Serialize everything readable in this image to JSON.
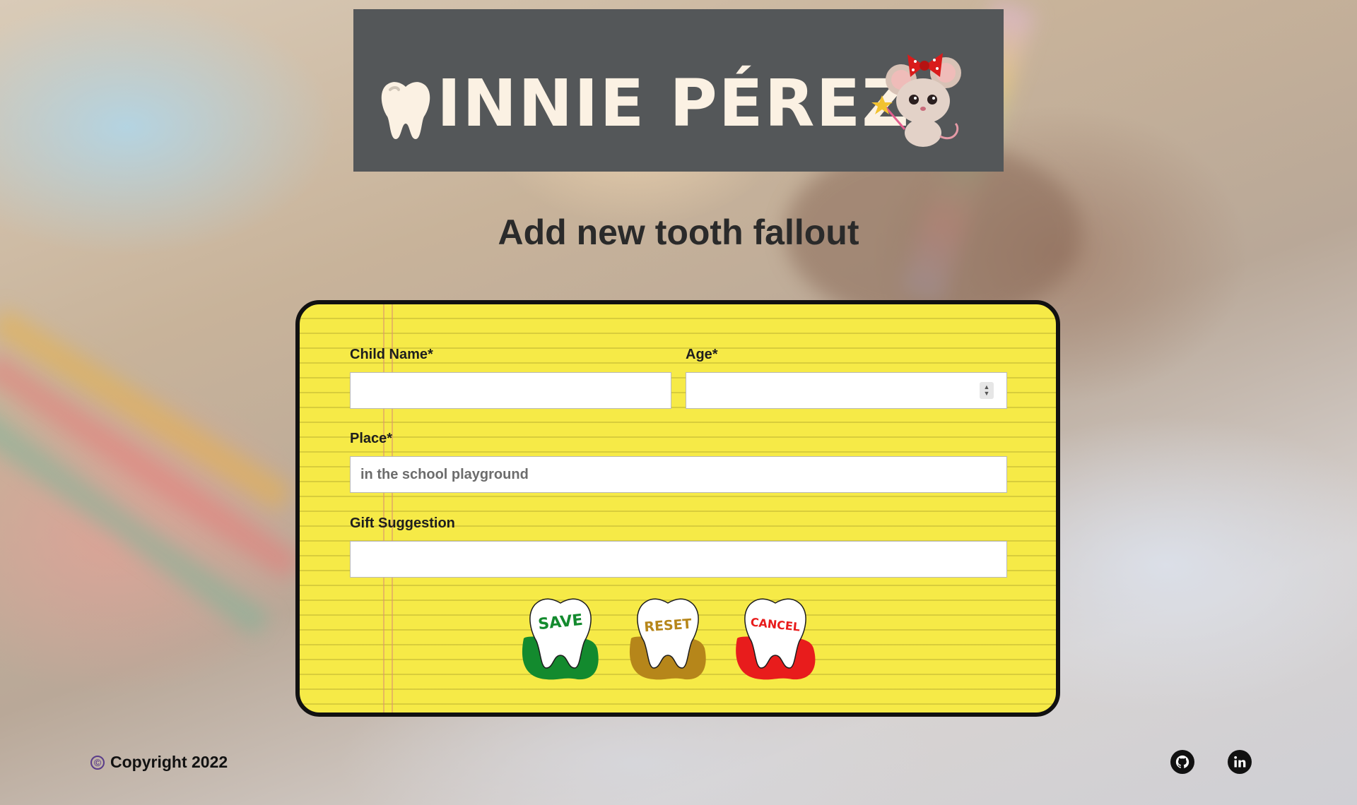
{
  "brand": {
    "name": "INNIE PÉREZ",
    "banner_bg": "#545759",
    "text_color": "#fbf1e3"
  },
  "page": {
    "title": "Add new tooth fallout"
  },
  "form": {
    "child_name": {
      "label": "Child Name*",
      "value": "",
      "placeholder": ""
    },
    "age": {
      "label": "Age*",
      "value": "",
      "placeholder": ""
    },
    "place": {
      "label": "Place*",
      "value": "",
      "placeholder": "in the school playground"
    },
    "gift": {
      "label": "Gift Suggestion",
      "value": "",
      "placeholder": ""
    },
    "card_color": "#f6ea47"
  },
  "buttons": {
    "save": {
      "label": "SAVE",
      "color": "#138a2e"
    },
    "reset": {
      "label": "RESET",
      "color": "#b6861a"
    },
    "cancel": {
      "label": "CANCEL",
      "color": "#e81c1c"
    }
  },
  "footer": {
    "copyright": "Copyright 2022",
    "copyright_icon": "copyright-icon",
    "github_icon": "github-icon",
    "linkedin_icon": "linkedin-icon"
  }
}
